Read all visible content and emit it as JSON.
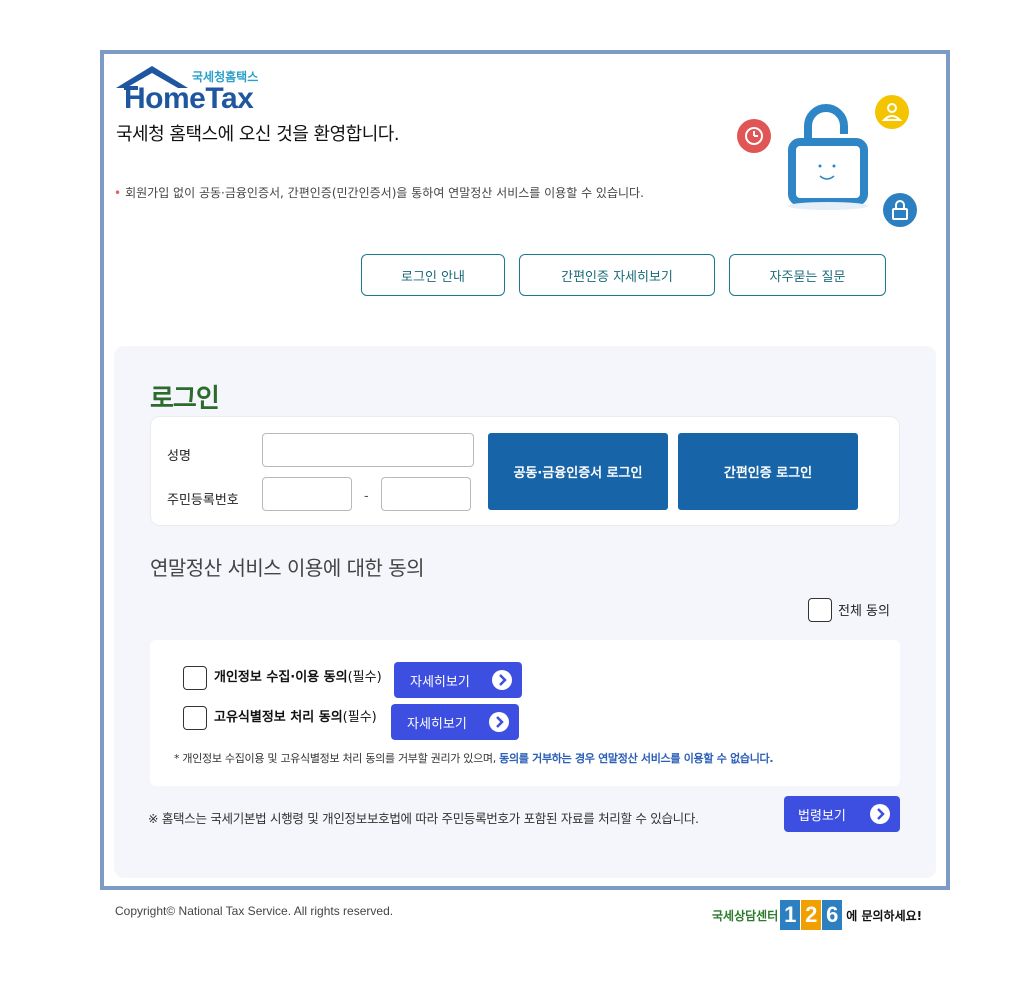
{
  "header": {
    "logo_small": "국세청홈택스",
    "logo_big": "HomeTax",
    "welcome": "국세청 홈택스에 오신 것을 환영합니다.",
    "notice": "회원가입 없이 공동·금융인증서, 간편인증(민간인증서)을 통하여 연말정산 서비스를 이용할 수 있습니다.",
    "guide_buttons": [
      "로그인 안내",
      "간편인증 자세히보기",
      "자주묻는 질문"
    ]
  },
  "login": {
    "title": "로그인",
    "name_label": "성명",
    "name_value": "",
    "rrn_label": "주민등록번호",
    "rrn_front_value": "",
    "rrn_back_value": "",
    "rrn_separator": "-",
    "cert_login_button": "공동·금융인증서 로그인",
    "simple_login_button": "간편인증 로그인"
  },
  "consent": {
    "title": "연말정산 서비스 이용에 대한 동의",
    "all_agree_label": "전체 동의",
    "items": [
      {
        "label": "개인정보 수집·이용 동의",
        "required": "(필수)",
        "detail_button": "자세히보기"
      },
      {
        "label": "고유식별정보 처리 동의",
        "required": "(필수)",
        "detail_button": "자세히보기"
      }
    ],
    "note_plain": "* 개인정보 수집이용 및 고유식별정보 처리 동의를 거부할 권리가 있으며, ",
    "note_highlight": "동의를 거부하는 경우 연말정산 서비스를 이용할 수 없습니다.",
    "law_note": "※ 홈택스는 국세기본법 시행령 및 개인정보보호법에 따라 주민등록번호가 포함된 자료를 처리할 수 있습니다.",
    "law_button": "법령보기"
  },
  "footer": {
    "copyright": "Copyright© National Tax Service. All rights reserved.",
    "center_pre": "국세상담센터",
    "center_digits": [
      "1",
      "2",
      "6"
    ],
    "center_post": "에 문의하세요!"
  },
  "colors": {
    "frame_border": "#7c9cc5",
    "login_title": "#2d6a2d",
    "login_button": "#1765a8",
    "detail_button": "#3d4fe0",
    "guide_border": "#1a7a8a"
  },
  "icons": [
    "house-logo-icon",
    "clock-icon",
    "user-icon",
    "lock-icon",
    "padlock-illustration",
    "arrow-right-icon",
    "checkbox-icon"
  ]
}
